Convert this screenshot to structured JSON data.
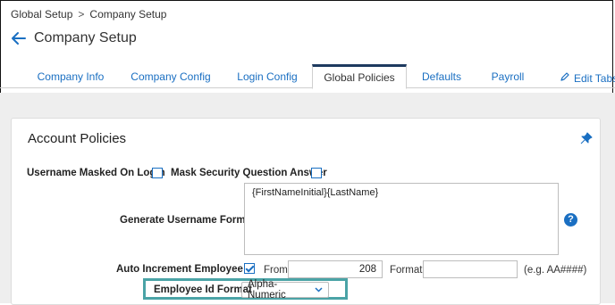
{
  "breadcrumb": {
    "root": "Global Setup",
    "separator": ">",
    "current": "Company Setup"
  },
  "page": {
    "title": "Company Setup"
  },
  "tabs": [
    {
      "label": "Company Info"
    },
    {
      "label": "Company Config"
    },
    {
      "label": "Login Config"
    },
    {
      "label": "Global Policies",
      "active": true
    },
    {
      "label": "Defaults"
    },
    {
      "label": "Payroll"
    }
  ],
  "edit_tabs": {
    "label": "Edit Tabs"
  },
  "card": {
    "title": "Account Policies"
  },
  "form": {
    "username_masked_label": "Username Masked On Login",
    "username_masked_checked": false,
    "mask_security_label": "Mask Security Question Answer",
    "mask_security_checked": false,
    "generate_username_label": "Generate Username Format",
    "generate_username_value": "{FirstNameInitial}{LastName}",
    "help_glyph": "?",
    "auto_increment_label": "Auto Increment Employee Id",
    "auto_increment_checked": true,
    "from_label": "From",
    "from_value": "208",
    "format_label": "Format",
    "format_value": "",
    "format_hint": "(e.g. AA####)",
    "employee_id_format_label": "Employee Id Format",
    "employee_id_format_value": "Alpha-Numeric"
  },
  "colors": {
    "link": "#1a6fc2",
    "active_tab_bar": "#1e3a5f",
    "highlight": "#4aa3a6"
  },
  "icons": {
    "back": "arrow-left-icon",
    "edit": "pencil-icon",
    "pin": "pin-icon",
    "help": "question-circle-icon",
    "dropdown": "chevron-down-icon"
  }
}
